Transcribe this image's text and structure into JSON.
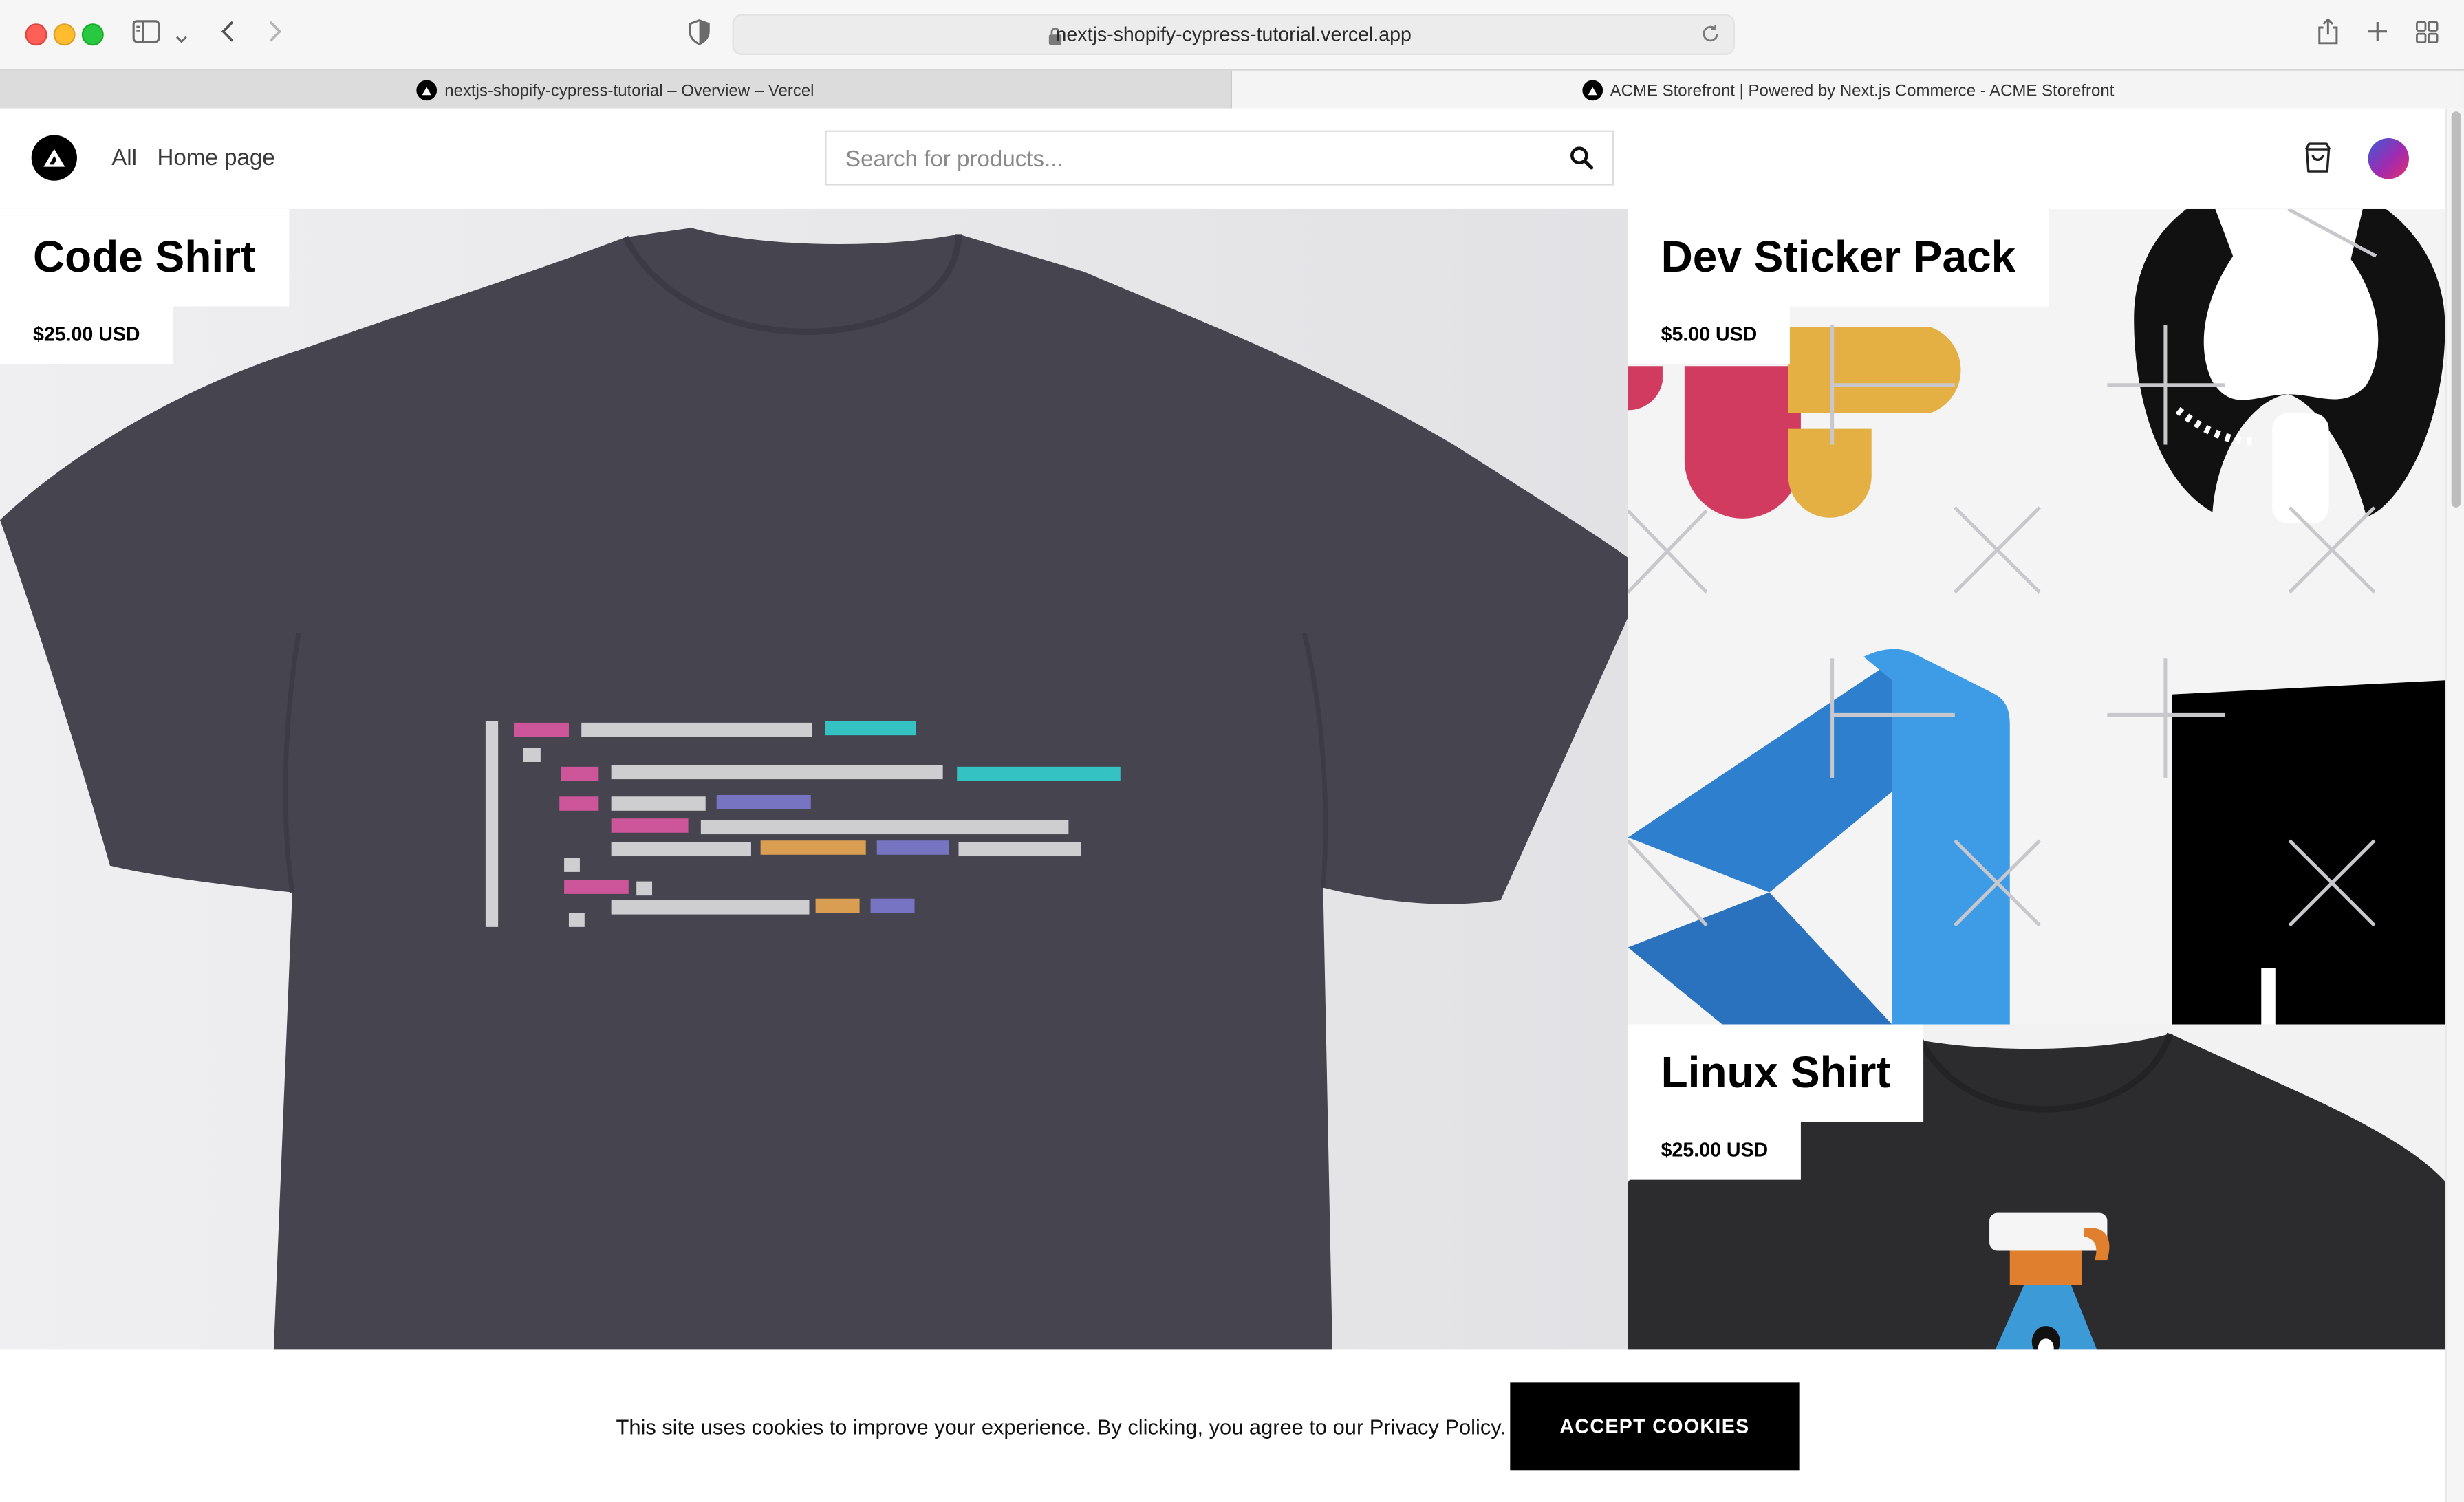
{
  "browser": {
    "url": "nextjs-shopify-cypress-tutorial.vercel.app",
    "tabs": [
      {
        "label": "nextjs-shopify-cypress-tutorial – Overview – Vercel",
        "active": false
      },
      {
        "label": "ACME Storefront | Powered by Next.js Commerce - ACME Storefront",
        "active": true
      }
    ]
  },
  "navbar": {
    "links": [
      "All",
      "Home page"
    ],
    "search_placeholder": "Search for products..."
  },
  "products": [
    {
      "title": "Code Shirt",
      "price": "$25.00 USD"
    },
    {
      "title": "Dev Sticker Pack",
      "price": "$5.00 USD"
    },
    {
      "title": "Linux Shirt",
      "price": "$25.00 USD"
    }
  ],
  "cookie_banner": {
    "message": "This site uses cookies to improve your experience. By clicking, you agree to our Privacy Policy.",
    "button_label": "ACCEPT COOKIES"
  },
  "colors": {
    "shirt": "#44434f",
    "linux_shirt": "#2a2a2c",
    "cookie_button": "#000000",
    "close_button": "#ff5f57",
    "minimize_button": "#febc2e",
    "zoom_button": "#28c840"
  },
  "icons": [
    "sidebar-icon",
    "chevron-down-icon",
    "back-arrow-icon",
    "forward-arrow-icon",
    "shield-icon",
    "lock-icon",
    "reload-icon",
    "share-icon",
    "new-tab-icon",
    "tab-overview-icon",
    "search-icon",
    "cart-icon"
  ]
}
